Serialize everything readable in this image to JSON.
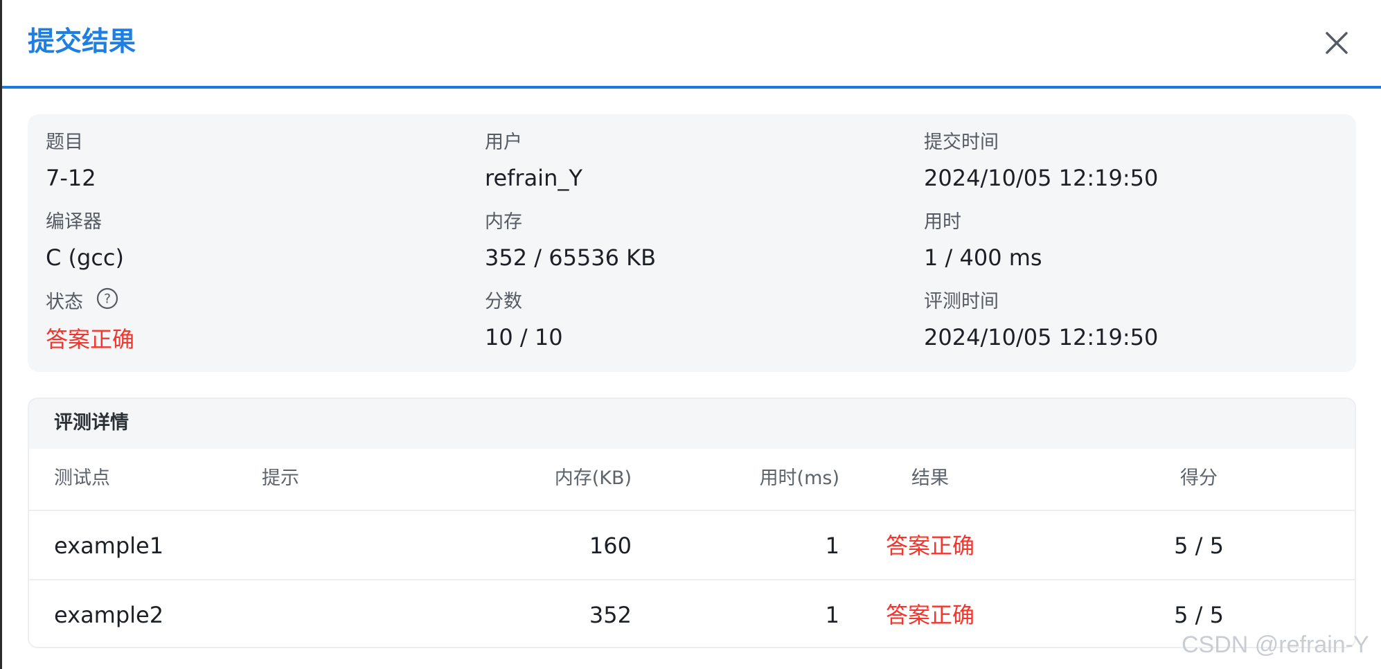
{
  "dialog": {
    "title": "提交结果"
  },
  "info": {
    "problem": {
      "label": "题目",
      "value": "7-12"
    },
    "user": {
      "label": "用户",
      "value": "refrain_Y"
    },
    "submit_time": {
      "label": "提交时间",
      "value": "2024/10/05 12:19:50"
    },
    "compiler": {
      "label": "编译器",
      "value": "C (gcc)"
    },
    "memory": {
      "label": "内存",
      "value": "352 / 65536 KB"
    },
    "time": {
      "label": "用时",
      "value": "1 / 400 ms"
    },
    "status": {
      "label": "状态",
      "value": "答案正确"
    },
    "score": {
      "label": "分数",
      "value": "10 / 10"
    },
    "judge_time": {
      "label": "评测时间",
      "value": "2024/10/05 12:19:50"
    }
  },
  "details": {
    "title": "评测详情",
    "columns": [
      "测试点",
      "提示",
      "内存(KB)",
      "用时(ms)",
      "结果",
      "得分"
    ],
    "rows": [
      {
        "case": "example1",
        "hint": "",
        "memory": "160",
        "time": "1",
        "result": "答案正确",
        "score": "5 / 5"
      },
      {
        "case": "example2",
        "hint": "",
        "memory": "352",
        "time": "1",
        "result": "答案正确",
        "score": "5 / 5"
      }
    ]
  },
  "watermark": "CSDN @refrain-Y",
  "icons": {
    "close": "close-icon",
    "help": "question-circle-icon"
  },
  "colors": {
    "accent": "#1e7fe0",
    "success_text": "#f5342c"
  }
}
